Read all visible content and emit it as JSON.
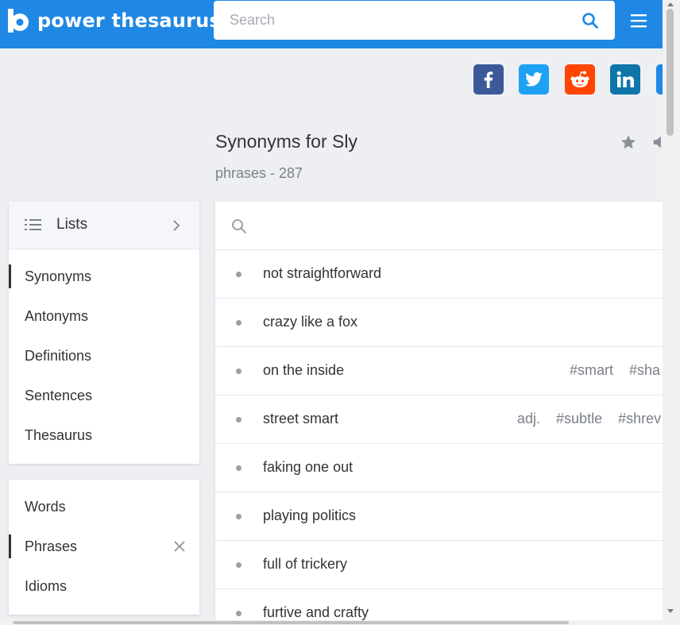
{
  "header": {
    "logo_text": "power thesaurus",
    "search_placeholder": "Search",
    "brand_color": "#1f88e5"
  },
  "share": {
    "items": [
      {
        "name": "facebook",
        "icon": "facebook-icon",
        "color": "#3b5998"
      },
      {
        "name": "twitter",
        "icon": "twitter-icon",
        "color": "#1da1f2"
      },
      {
        "name": "reddit",
        "icon": "reddit-icon",
        "color": "#ff4500"
      },
      {
        "name": "linkedin",
        "icon": "linkedin-icon",
        "color": "#0e76a8"
      }
    ]
  },
  "page": {
    "title": "Synonyms for Sly",
    "subtitle": "phrases - 287"
  },
  "lists": {
    "label": "Lists",
    "items": [
      {
        "label": "Synonyms",
        "active": true
      },
      {
        "label": "Antonyms",
        "active": false
      },
      {
        "label": "Definitions",
        "active": false
      },
      {
        "label": "Sentences",
        "active": false
      },
      {
        "label": "Thesaurus",
        "active": false
      }
    ]
  },
  "types": {
    "items": [
      {
        "label": "Words",
        "active": false
      },
      {
        "label": "Phrases",
        "active": true
      },
      {
        "label": "Idioms",
        "active": false
      }
    ]
  },
  "results": {
    "rows": [
      {
        "term": "not straightforward",
        "tags": []
      },
      {
        "term": "crazy like a fox",
        "tags": []
      },
      {
        "term": "on the inside",
        "tags": [
          "#smart",
          "#sha"
        ]
      },
      {
        "term": "street smart",
        "tags": [
          "adj.",
          "#subtle",
          "#shrev"
        ]
      },
      {
        "term": "faking one out",
        "tags": []
      },
      {
        "term": "playing politics",
        "tags": []
      },
      {
        "term": "full of trickery",
        "tags": []
      },
      {
        "term": "furtive and crafty",
        "tags": []
      }
    ]
  }
}
